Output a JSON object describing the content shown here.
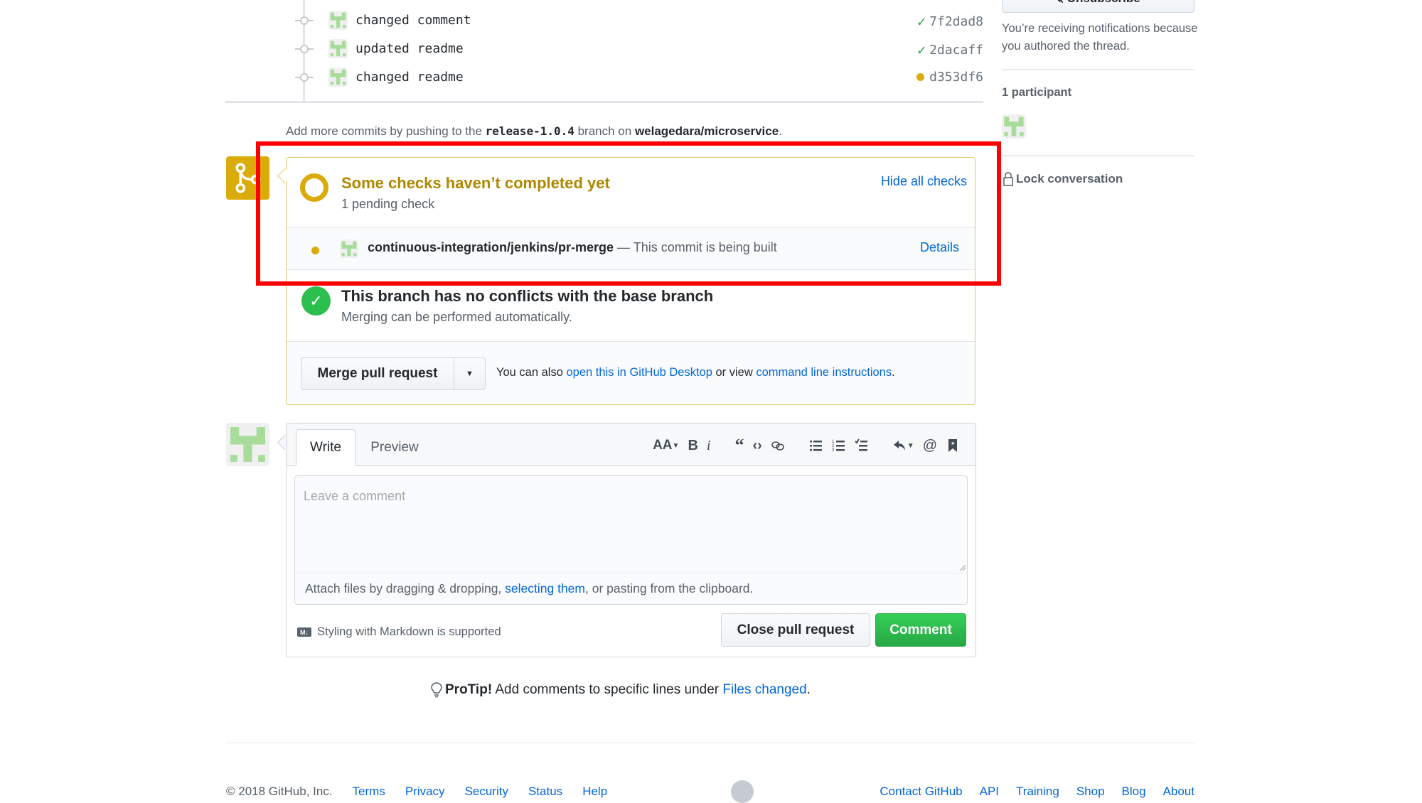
{
  "commits": [
    {
      "message": "changed comment",
      "sha": "7f2dad8",
      "status": "success"
    },
    {
      "message": "updated readme",
      "sha": "2dacaff",
      "status": "success"
    },
    {
      "message": "changed readme",
      "sha": "d353df6",
      "status": "pending"
    }
  ],
  "add_more": {
    "prefix": "Add more commits by pushing to the ",
    "branch": "release-1.0.4",
    "middle": " branch on ",
    "repo": "welagedara/microservice",
    "suffix": "."
  },
  "checks": {
    "title": "Some checks haven’t completed yet",
    "subtitle": "1 pending check",
    "toggle_label": "Hide all checks",
    "items": [
      {
        "context": "continuous-integration/jenkins/pr-merge",
        "description": " — This commit is being built",
        "details_label": "Details",
        "state": "pending"
      }
    ]
  },
  "mergeability": {
    "title": "This branch has no conflicts with the base branch",
    "subtitle": "Merging can be performed automatically."
  },
  "merge": {
    "button_label": "Merge pull request",
    "alt_prefix": "You can also ",
    "desktop_link": "open this in GitHub Desktop",
    "alt_middle": " or view ",
    "cli_link": "command line instructions",
    "alt_suffix": "."
  },
  "comment": {
    "tabs": [
      "Write",
      "Preview"
    ],
    "toolbar": [
      "header",
      "bold",
      "italic",
      "quote",
      "code",
      "link",
      "unordered-list",
      "ordered-list",
      "task-list",
      "reply",
      "mention",
      "saved-reply"
    ],
    "placeholder": "Leave a comment",
    "attach_prefix": "Attach files by dragging & dropping, ",
    "attach_link": "selecting them",
    "attach_suffix": ", or pasting from the clipboard.",
    "markdown_hint": "Styling with Markdown is supported",
    "close_label": "Close pull request",
    "submit_label": "Comment"
  },
  "protip": {
    "bold": "ProTip!",
    "text": " Add comments to specific lines under ",
    "link": "Files changed",
    "suffix": "."
  },
  "sidebar": {
    "unsubscribe_label": "Unsubscribe",
    "notification_text": "You’re receiving notifications because you authored the thread.",
    "participants_label": "1 participant",
    "lock_label": "Lock conversation"
  },
  "footer": {
    "copyright": "© 2018 GitHub, Inc.",
    "left_links": [
      "Terms",
      "Privacy",
      "Security",
      "Status",
      "Help"
    ],
    "right_links": [
      "Contact GitHub",
      "API",
      "Training",
      "Shop",
      "Blog",
      "About"
    ]
  },
  "colors": {
    "pending": "#dbab09",
    "success": "#28a745",
    "link": "#0366d6",
    "highlight": "#ff0000"
  }
}
